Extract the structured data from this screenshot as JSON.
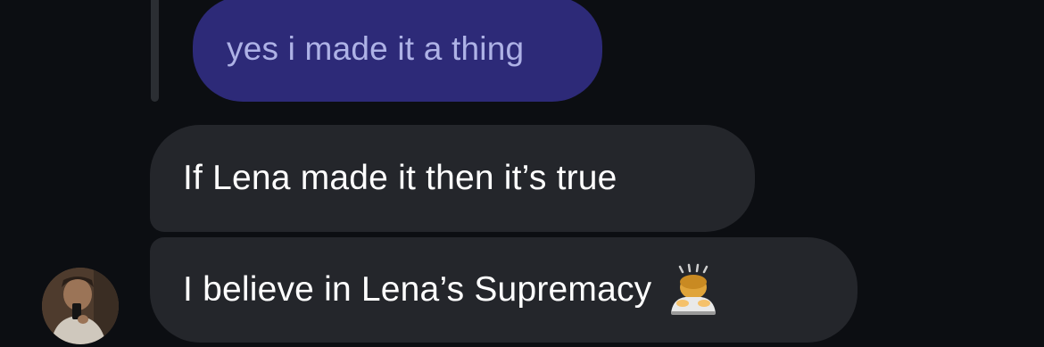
{
  "thread": {
    "quoted_message": {
      "text": "yes i made it a thing"
    },
    "messages": [
      {
        "text": "If Lena made it then it’s true"
      },
      {
        "text": "I believe in Lena’s Supremacy",
        "emoji": "person-bowing-emoji"
      }
    ]
  },
  "colors": {
    "background": "#0c0e12",
    "outgoing_bubble": "#2d2a78",
    "incoming_bubble": "#24262b"
  }
}
